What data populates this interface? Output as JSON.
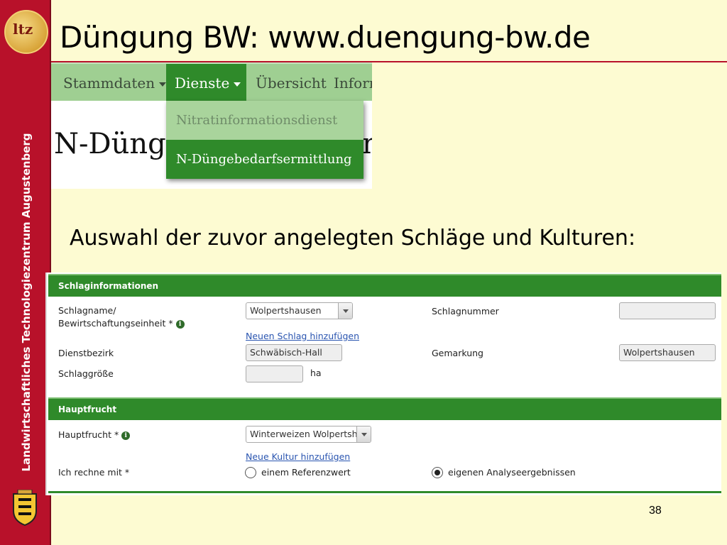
{
  "slide": {
    "title": "Düngung BW: www.duengung-bw.de",
    "subtitle": "Auswahl der zuvor angelegten Schläge und Kulturen:",
    "page_number": "38"
  },
  "sidebar": {
    "logo_text": "ltz",
    "vertical_text": "Landwirtschaftliches Technologiezentrum Augustenberg"
  },
  "nav": {
    "items": [
      "Stammdaten",
      "Dienste",
      "Übersicht",
      "Inform"
    ],
    "active_index": 1,
    "heading_behind": "N-Dünge",
    "heading_tail": "n",
    "dropdown": [
      "Nitratinformationsdienst",
      "N-Düngebedarfsermittlung"
    ],
    "dropdown_selected_index": 1
  },
  "form": {
    "schlag_section": "Schlaginformationen",
    "schlagname_label_1": "Schlagname/",
    "schlagname_label_2": "Bewirtschaftungseinheit *",
    "schlagname_value": "Wolpertshausen",
    "schlagnummer_label": "Schlagnummer",
    "schlagnummer_value": "",
    "neuer_schlag_link": "Neuen Schlag hinzufügen",
    "dienstbezirk_label": "Dienstbezirk",
    "dienstbezirk_value": "Schwäbisch-Hall",
    "gemarkung_label": "Gemarkung",
    "gemarkung_value": "Wolpertshausen",
    "schlaggroesse_label": "Schlaggröße",
    "schlaggroesse_value": "",
    "schlaggroesse_unit": "ha",
    "hauptfrucht_section": "Hauptfrucht",
    "hauptfrucht_label": "Hauptfrucht *",
    "hauptfrucht_value": "Winterweizen Wolpertshau",
    "neue_kultur_link": "Neue Kultur hinzufügen",
    "rechne_label": "Ich rechne mit *",
    "radio_referenz": "einem Referenzwert",
    "radio_analyse": "eigenen Analyseergebnissen",
    "radio_selected": "eigenen Analyseergebnissen"
  },
  "colors": {
    "background": "#fdfbd2",
    "sidebar_red": "#b8112a",
    "nav_green": "#2f8a2a",
    "nav_light_green": "#9fcf92",
    "link_blue": "#2a55b0"
  }
}
